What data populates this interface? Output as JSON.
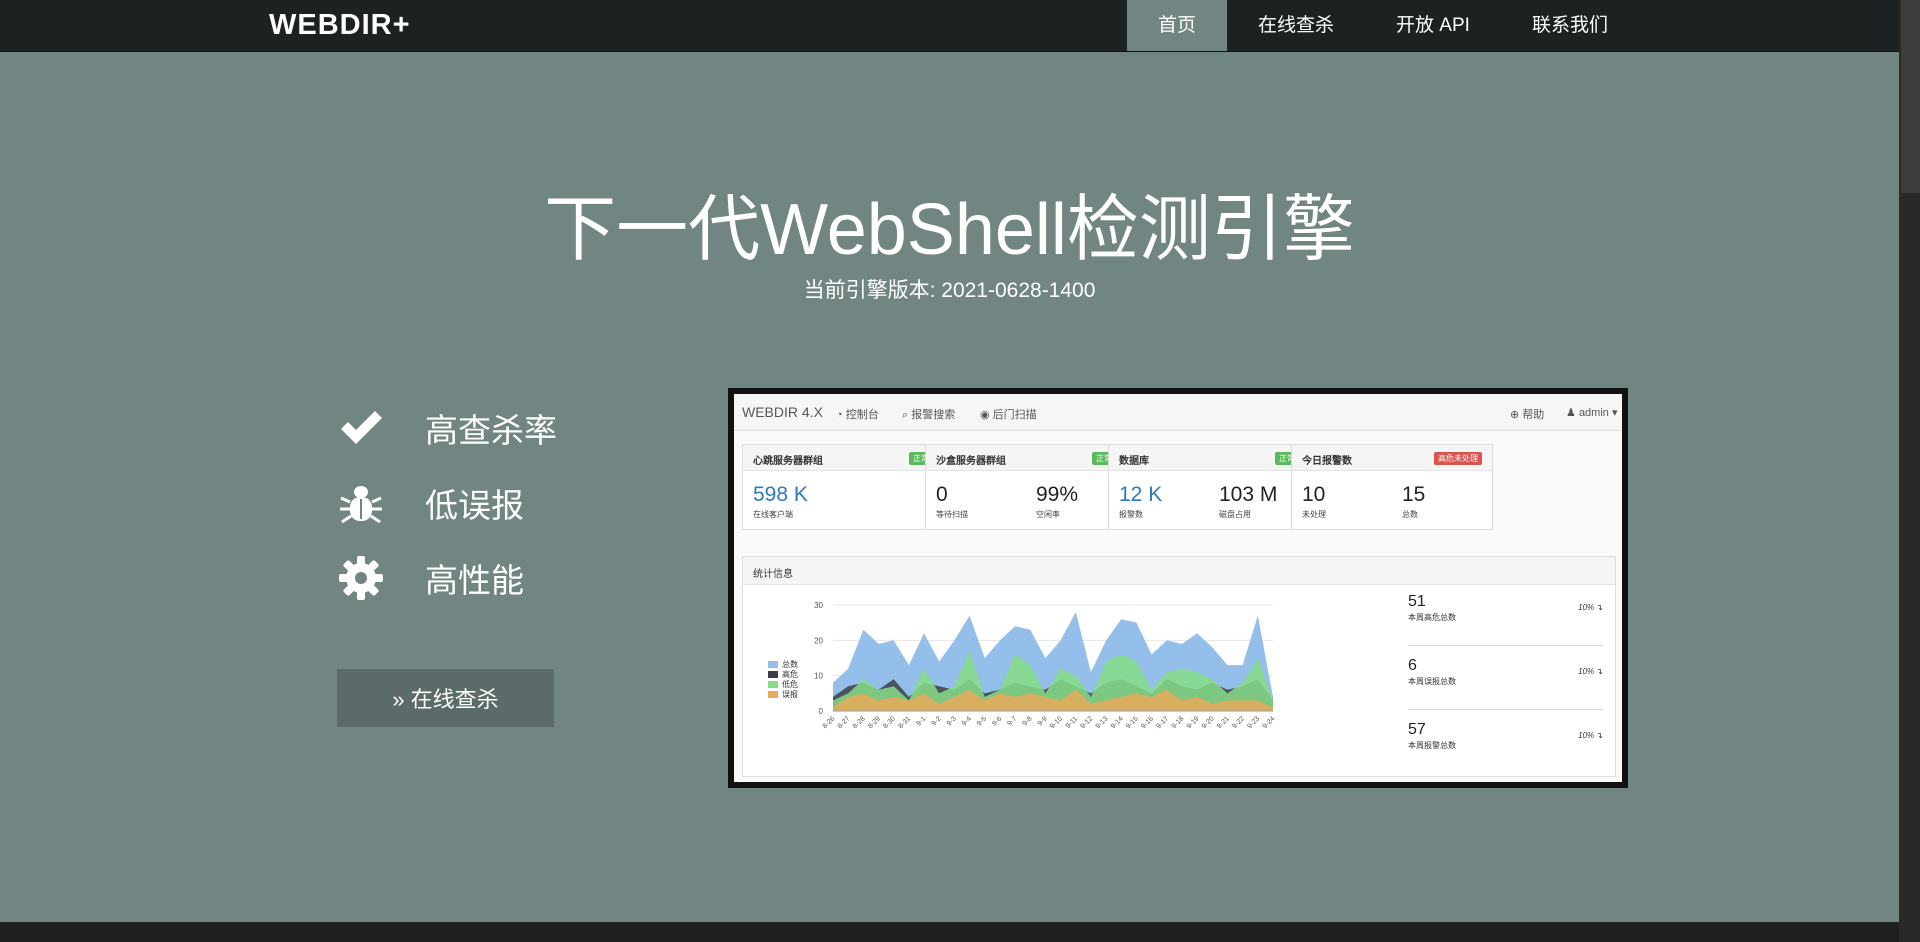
{
  "navbar": {
    "brand": "WEBDIR+",
    "items": [
      {
        "label": "首页",
        "active": true
      },
      {
        "label": "在线查杀",
        "active": false
      },
      {
        "label": "开放 API",
        "active": false
      },
      {
        "label": "联系我们",
        "active": false
      }
    ]
  },
  "hero": {
    "title": "下一代WebShell检测引擎",
    "subtitle": "当前引擎版本: 2021-0628-1400"
  },
  "features": [
    {
      "icon": "check-icon",
      "label": "高查杀率"
    },
    {
      "icon": "bug-icon",
      "label": "低误报"
    },
    {
      "icon": "gear-icon",
      "label": "高性能"
    }
  ],
  "cta": {
    "label": "» 在线查杀"
  },
  "dashboard": {
    "brand": "WEBDIR 4.X",
    "nav": [
      "控制台",
      "报警搜索",
      "后门扫描"
    ],
    "help": "帮助",
    "user": "admin",
    "cards": [
      {
        "title": "心跳服务器群组",
        "badge": "正常",
        "badge_color": "#5cb85c",
        "values": [
          {
            "value": "598 K",
            "label": "在线客户端",
            "blue": true
          }
        ]
      },
      {
        "title": "沙盒服务器群组",
        "badge": "正常",
        "badge_color": "#5cb85c",
        "values": [
          {
            "value": "0",
            "label": "等待扫描",
            "blue": false
          },
          {
            "value": "99%",
            "label": "空闲率",
            "blue": false
          }
        ]
      },
      {
        "title": "数据库",
        "badge": "正常",
        "badge_color": "#5cb85c",
        "values": [
          {
            "value": "12 K",
            "label": "报警数",
            "blue": true
          },
          {
            "value": "103 M",
            "label": "磁盘占用",
            "blue": false
          }
        ]
      },
      {
        "title": "今日报警数",
        "badge": "高危未处理",
        "badge_color": "#d9534f",
        "values": [
          {
            "value": "10",
            "label": "未处理",
            "blue": false
          },
          {
            "value": "15",
            "label": "总数",
            "blue": false
          }
        ]
      }
    ],
    "stats_title": "统计信息",
    "side_stats": [
      {
        "value": "51",
        "label": "本周高危总数",
        "pct": "10%"
      },
      {
        "value": "6",
        "label": "本周误报总数",
        "pct": "10%"
      },
      {
        "value": "57",
        "label": "本周报警总数",
        "pct": "10%"
      }
    ]
  },
  "chart_data": {
    "type": "area",
    "x": [
      "8-26",
      "8-27",
      "8-28",
      "8-29",
      "8-30",
      "8-31",
      "9-1",
      "9-2",
      "9-3",
      "9-4",
      "9-5",
      "9-6",
      "9-7",
      "9-8",
      "9-9",
      "9-10",
      "9-11",
      "9-12",
      "9-13",
      "9-14",
      "9-15",
      "9-16",
      "9-17",
      "9-18",
      "9-19",
      "9-20",
      "9-21",
      "9-22",
      "9-23",
      "9-24"
    ],
    "ylim": [
      0,
      30
    ],
    "yticks": [
      0,
      10,
      20,
      30
    ],
    "series": [
      {
        "name": "总数",
        "color": "#94bfeb",
        "values": [
          8,
          12,
          23,
          19,
          20,
          13,
          22,
          14,
          20,
          27,
          15,
          20,
          24,
          23,
          15,
          20,
          28,
          11,
          20,
          26,
          25,
          16,
          20,
          19,
          22,
          18,
          13,
          13,
          27,
          4
        ]
      },
      {
        "name": "高危",
        "color": "#3d3f47",
        "values": [
          4,
          7,
          8,
          6,
          9,
          4,
          8,
          7,
          6,
          9,
          5,
          6,
          8,
          7,
          6,
          9,
          7,
          5,
          8,
          9,
          7,
          5,
          9,
          7,
          6,
          8,
          6,
          7,
          9,
          3
        ]
      },
      {
        "name": "低危",
        "color": "#86dd86",
        "values": [
          3,
          5,
          9,
          6,
          7,
          3,
          12,
          5,
          7,
          17,
          4,
          6,
          16,
          13,
          5,
          12,
          10,
          4,
          14,
          16,
          14,
          6,
          11,
          12,
          11,
          9,
          5,
          8,
          15,
          3
        ]
      },
      {
        "name": "误报",
        "color": "#e8a95a",
        "values": [
          1,
          4,
          5,
          3,
          4,
          3,
          5,
          2,
          4,
          6,
          3,
          5,
          4,
          5,
          4,
          3,
          6,
          2,
          3,
          4,
          5,
          4,
          6,
          3,
          4,
          2,
          3,
          3,
          3,
          1
        ]
      }
    ]
  }
}
